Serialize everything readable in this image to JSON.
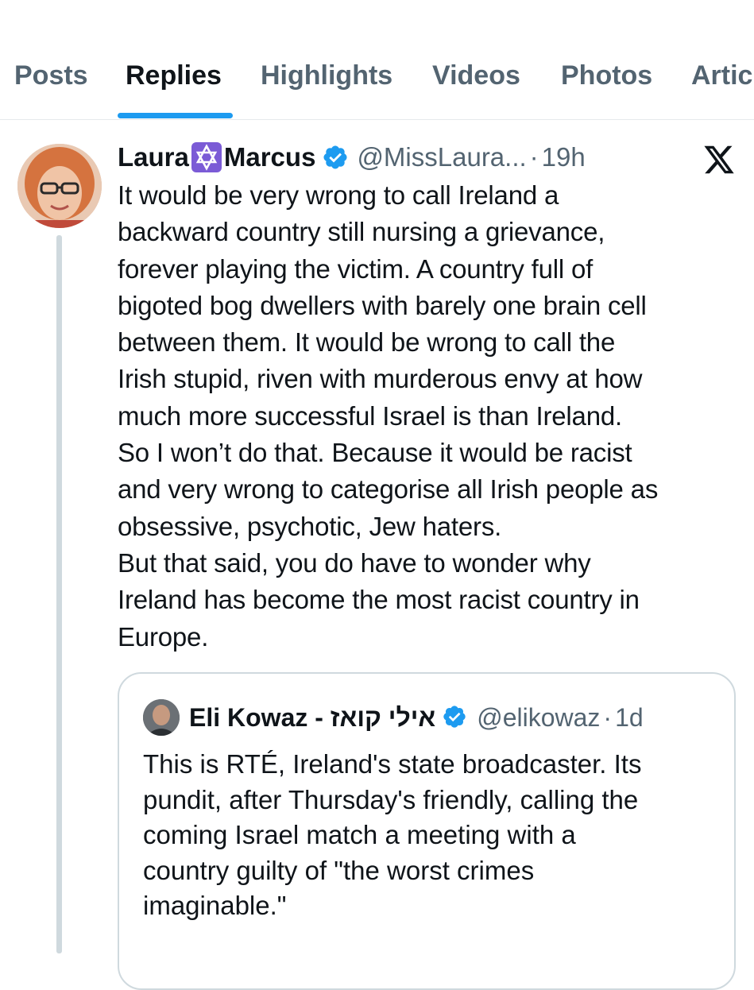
{
  "tabs": [
    {
      "label": "Posts"
    },
    {
      "label": "Replies"
    },
    {
      "label": "Highlights"
    },
    {
      "label": "Videos"
    },
    {
      "label": "Photos"
    },
    {
      "label": "Artic"
    }
  ],
  "active_tab": "Replies",
  "colors": {
    "accent": "#1d9bf0",
    "verified": "#1d9bf0",
    "badge": "#7b5bd6",
    "secondary_text": "#536471"
  },
  "tweet": {
    "name_first": "Laura",
    "name_last": "Marcus",
    "name_emoji": "star-of-david-icon",
    "handle": "@MissLaura...",
    "separator": "·",
    "time": "19h",
    "lines": [
      "It would be very wrong to call Ireland a",
      "backward country still nursing a grievance,",
      "forever playing the victim. A country full of",
      "bigoted bog dwellers with barely one brain cell",
      "between them. It would be wrong to call the",
      "Irish stupid, riven with murderous envy at how",
      "much more successful Israel is than Ireland.",
      "So I won’t do that. Because it would be racist",
      "and very wrong to categorise all Irish people as",
      "obsessive, psychotic, Jew haters.",
      "But that said, you do have to wonder why",
      "Ireland has become the most racist country in",
      "Europe."
    ]
  },
  "quote": {
    "name": "Eli Kowaz - אילי קואז",
    "handle": "@elikowaz",
    "separator": "·",
    "time": "1d",
    "lines": [
      "This is RTÉ, Ireland's state broadcaster. Its",
      "pundit, after Thursday's friendly, calling the",
      "coming Israel match a meeting with a",
      "country guilty of \"the worst crimes",
      "imaginable.\""
    ]
  }
}
